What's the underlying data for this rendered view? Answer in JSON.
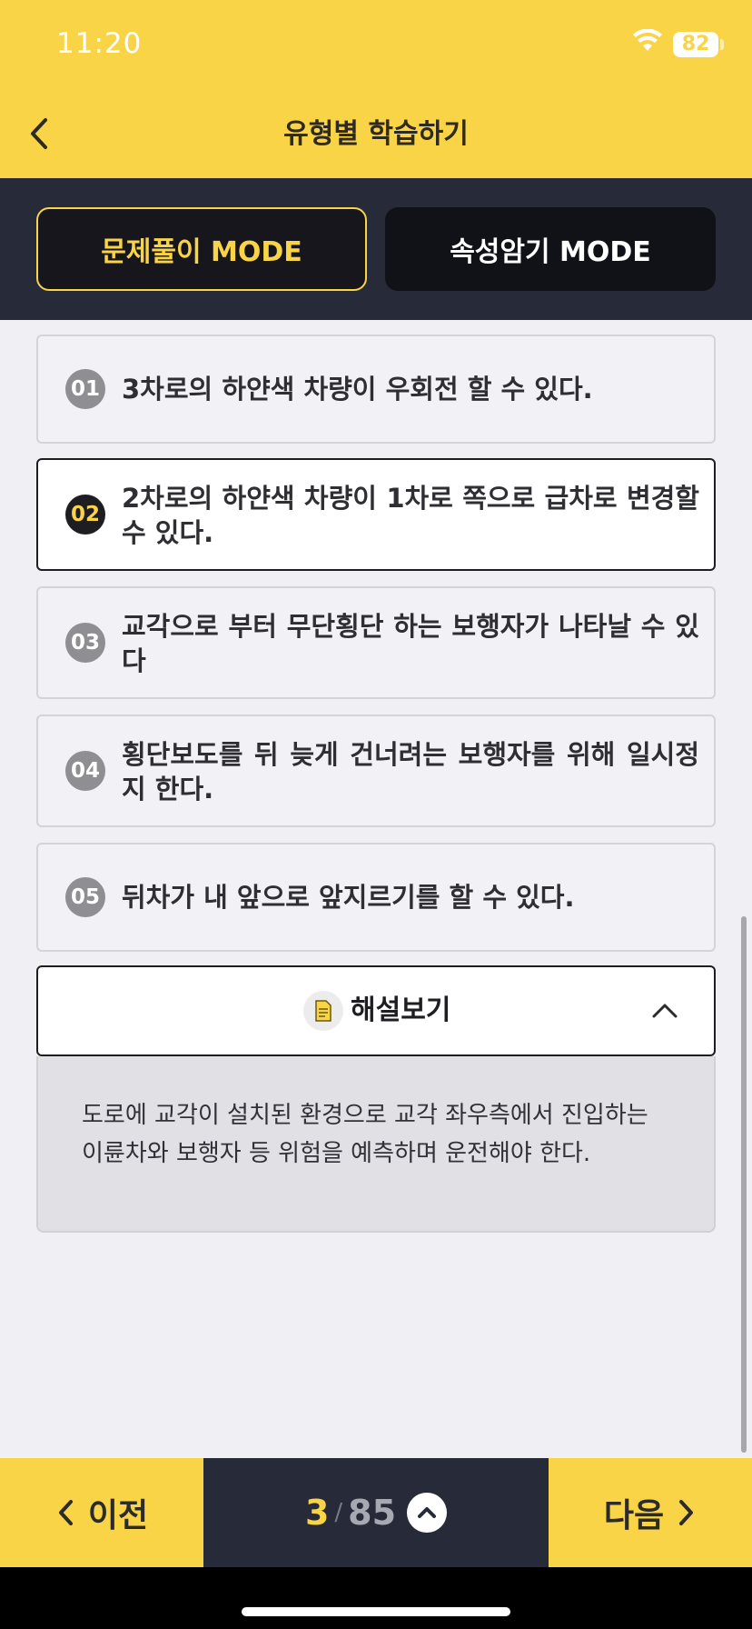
{
  "status_bar": {
    "time": "11:20",
    "battery": "82"
  },
  "header": {
    "title": "유형별 학습하기"
  },
  "modes": {
    "active": "문제풀이 MODE",
    "inactive": "속성암기 MODE"
  },
  "options": [
    {
      "num": "01",
      "text": "3차로의 하얀색 차량이 우회전 할 수 있다."
    },
    {
      "num": "02",
      "text": "2차로의 하얀색 차량이 1차로 쪽으로 급차로 변경할 수 있다."
    },
    {
      "num": "03",
      "text": "교각으로 부터 무단횡단 하는 보행자가 나타날 수 있다"
    },
    {
      "num": "04",
      "text": "횡단보도를 뒤 늦게 건너려는 보행자를 위해 일시정지 한다."
    },
    {
      "num": "05",
      "text": "뒤차가 내 앞으로 앞지르기를 할 수 있다."
    }
  ],
  "explanation": {
    "label": "해설보기",
    "text": "도로에 교각이 설치된 환경으로 교각 좌우측에서 진입하는 이륜차와 보행자 등 위험을 예측하며 운전해야 한다."
  },
  "nav": {
    "prev": "이전",
    "current": "3",
    "separator": "/",
    "total": "85",
    "next": "다음"
  },
  "icons": {
    "back": "chevron-left-icon",
    "wifi": "wifi-icon",
    "document": "document-icon",
    "collapse": "chevron-up-icon",
    "prev": "chevron-left-icon",
    "next": "chevron-right-icon",
    "question_list": "chevron-up-circle-icon"
  },
  "colors": {
    "accent": "#f9d447",
    "dark": "#272a38",
    "selected_border": "#1e1e22"
  }
}
